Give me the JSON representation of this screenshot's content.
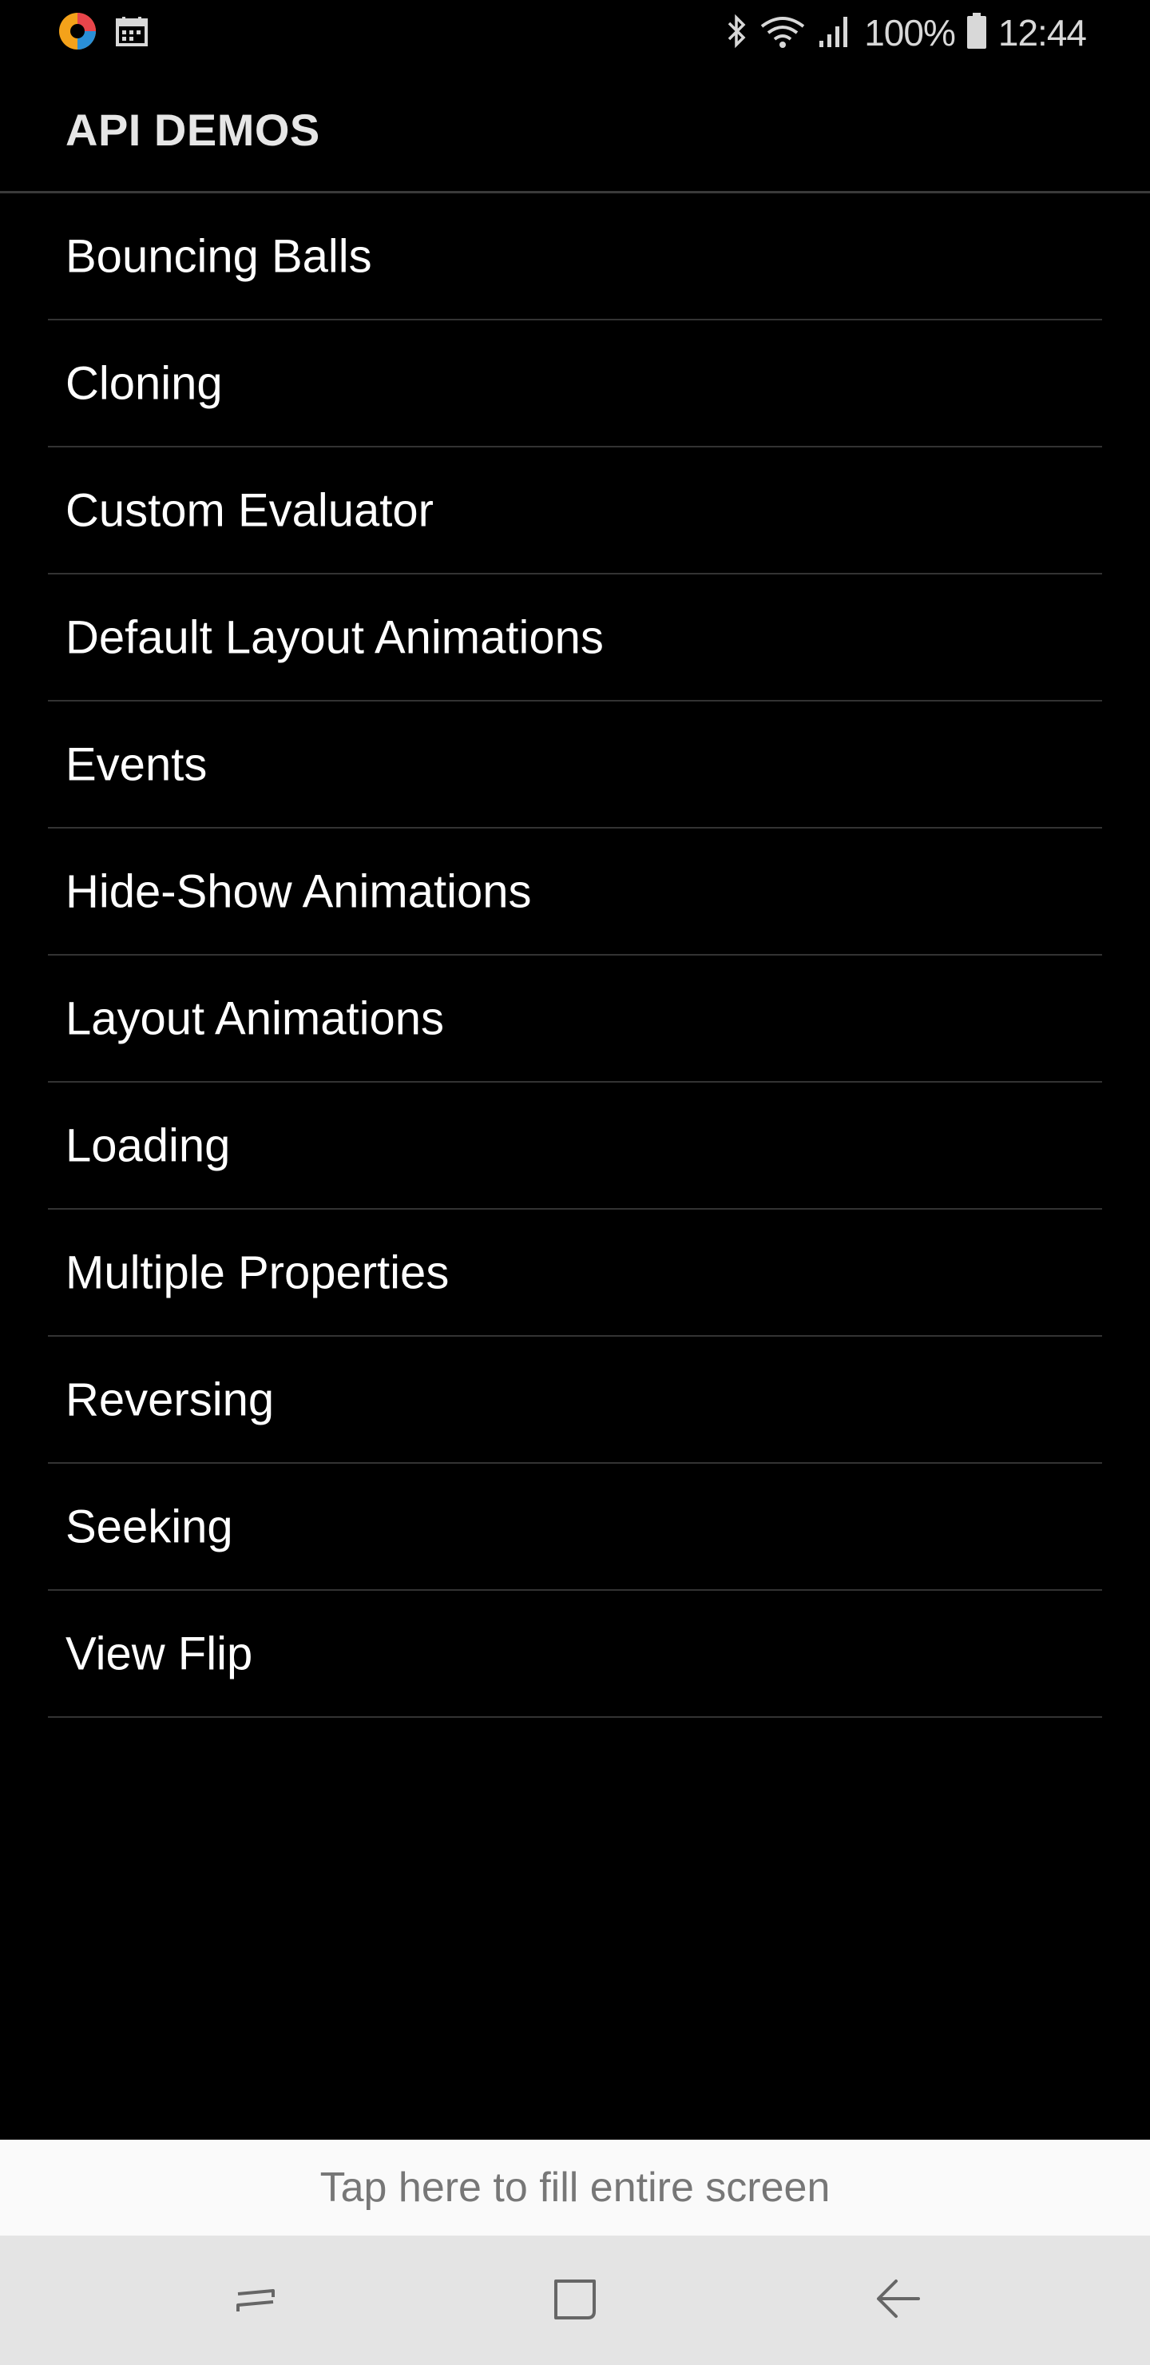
{
  "status_bar": {
    "battery": "100%",
    "time": "12:44"
  },
  "app_bar": {
    "title": "API DEMOS"
  },
  "list": {
    "items": [
      {
        "label": "Bouncing Balls"
      },
      {
        "label": "Cloning"
      },
      {
        "label": "Custom Evaluator"
      },
      {
        "label": "Default Layout Animations"
      },
      {
        "label": "Events"
      },
      {
        "label": "Hide-Show Animations"
      },
      {
        "label": "Layout Animations"
      },
      {
        "label": "Loading"
      },
      {
        "label": "Multiple Properties"
      },
      {
        "label": "Reversing"
      },
      {
        "label": "Seeking"
      },
      {
        "label": "View Flip"
      }
    ]
  },
  "fill_banner": {
    "text": "Tap here to fill entire screen"
  },
  "icons": {
    "status_left": [
      "app-logo-icon",
      "calendar-icon"
    ],
    "status_right": [
      "bluetooth-icon",
      "wifi-icon",
      "signal-icon",
      "battery-icon"
    ],
    "nav": [
      "recent-apps-icon",
      "home-icon",
      "back-icon"
    ]
  }
}
